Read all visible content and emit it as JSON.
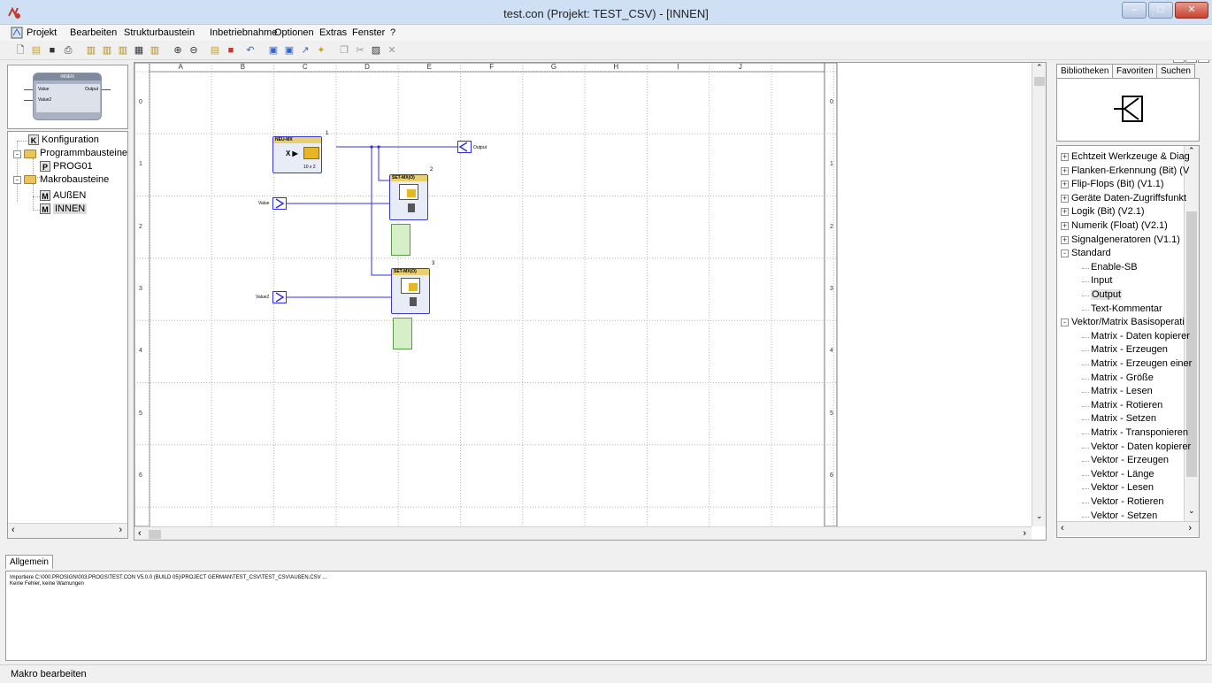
{
  "window": {
    "title": "test.con  (Projekt: TEST_CSV)  - [INNEN]"
  },
  "menu": [
    "Projekt",
    "Bearbeiten",
    "Strukturbaustein",
    "Inbetriebnahme",
    "Optionen",
    "Extras",
    "Fenster",
    "?"
  ],
  "preview": {
    "block_title": "INNEN",
    "in1": "Value",
    "in2": "Value2",
    "out1": "Output"
  },
  "tree": {
    "konfiguration": "Konfiguration",
    "programmbausteine": "Programmbausteine",
    "prog01": "PROG01",
    "makrobausteine": "Makrobausteine",
    "aussen": "AUßEN",
    "innen": "INNEN"
  },
  "grid": {
    "columns": [
      "A",
      "B",
      "C",
      "D",
      "E",
      "F",
      "G",
      "H",
      "I",
      "J"
    ],
    "rows": [
      "0",
      "1",
      "2",
      "3",
      "4",
      "5",
      "6"
    ]
  },
  "blocks": {
    "neu": {
      "title": "NEU-MX",
      "num": "1",
      "size": "10 x 2"
    },
    "set1": {
      "title": "SET-MX(O)",
      "num": "2"
    },
    "set2": {
      "title": "SET-MX(O)",
      "num": "3"
    },
    "input1": "Value",
    "input2": "Value2",
    "output1": "Output"
  },
  "library": {
    "tabs": [
      "Bibliotheken",
      "Favoriten",
      "Suchen"
    ],
    "items": [
      {
        "label": "Echtzeit Werkzeuge & Diag",
        "type": "group"
      },
      {
        "label": "Flanken-Erkennung (Bit) (V",
        "type": "group"
      },
      {
        "label": "Flip-Flops (Bit) (V1.1)",
        "type": "group"
      },
      {
        "label": "Geräte Daten-Zugriffsfunkt",
        "type": "group"
      },
      {
        "label": "Logik (Bit) (V2.1)",
        "type": "group"
      },
      {
        "label": "Numerik (Float) (V2.1)",
        "type": "group"
      },
      {
        "label": "Signalgeneratoren (V1.1)",
        "type": "group"
      },
      {
        "label": "Standard",
        "type": "open"
      },
      {
        "label": "Enable-SB",
        "type": "leaf"
      },
      {
        "label": "Input",
        "type": "leaf"
      },
      {
        "label": "Output",
        "type": "leaf-selected"
      },
      {
        "label": "Text-Kommentar",
        "type": "leaf"
      },
      {
        "label": "Vektor/Matrix Basisoperati",
        "type": "open"
      },
      {
        "label": "Matrix - Daten kopierer",
        "type": "leaf"
      },
      {
        "label": "Matrix - Erzeugen",
        "type": "leaf"
      },
      {
        "label": "Matrix - Erzeugen einer",
        "type": "leaf"
      },
      {
        "label": "Matrix - Größe",
        "type": "leaf"
      },
      {
        "label": "Matrix - Lesen",
        "type": "leaf"
      },
      {
        "label": "Matrix - Rotieren",
        "type": "leaf"
      },
      {
        "label": "Matrix - Setzen",
        "type": "leaf"
      },
      {
        "label": "Matrix - Transponieren",
        "type": "leaf"
      },
      {
        "label": "Vektor - Daten kopierer",
        "type": "leaf"
      },
      {
        "label": "Vektor - Erzeugen",
        "type": "leaf"
      },
      {
        "label": "Vektor - Länge",
        "type": "leaf"
      },
      {
        "label": "Vektor - Lesen",
        "type": "leaf"
      },
      {
        "label": "Vektor - Rotieren",
        "type": "leaf"
      },
      {
        "label": "Vektor - Setzen",
        "type": "leaf"
      }
    ]
  },
  "log": {
    "tab": "Allgemein",
    "line1": "Importiere C:\\000.PROSIGN\\003.PROGS\\TEST.CON V5.0.0 (BUILD 05)\\PROJECT GERMAN\\TEST_CSV\\TEST_CSV\\AUßEN.CSV ...",
    "line2": "Keine Fehler, keine Warnungen"
  },
  "status": {
    "text": "Makro bearbeiten"
  }
}
